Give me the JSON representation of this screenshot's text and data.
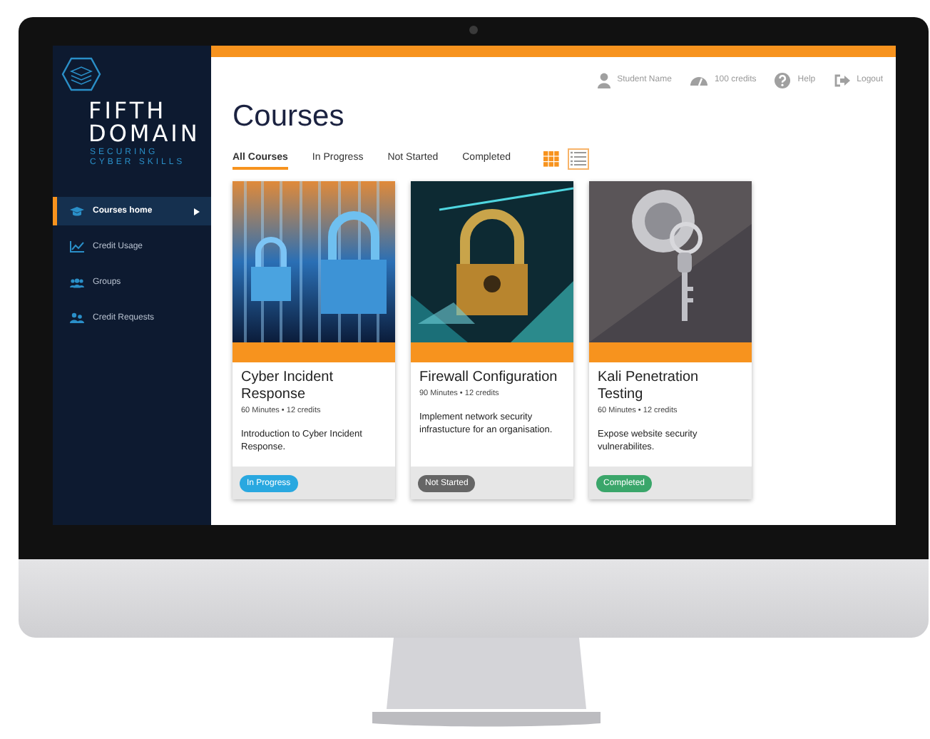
{
  "brand": {
    "name_line_1": "FIFTH",
    "name_line_2": "DOMAIN",
    "tagline_line_1": "SECURING",
    "tagline_line_2": "CYBER SKILLS"
  },
  "sidebar": {
    "items": [
      {
        "label": "Courses home",
        "kind": "courses",
        "selected": true
      },
      {
        "label": "Credit Usage",
        "kind": "chart",
        "selected": false
      },
      {
        "label": "Groups",
        "kind": "groups",
        "selected": false
      },
      {
        "label": "Credit Requests",
        "kind": "requests",
        "selected": false
      }
    ]
  },
  "header": {
    "links": [
      {
        "label": "Student Name",
        "kind": "user"
      },
      {
        "label": "100 credits",
        "kind": "credits"
      },
      {
        "label": "Help",
        "kind": "help"
      },
      {
        "label": "Logout",
        "kind": "logout"
      }
    ]
  },
  "page_title": "Courses",
  "tabs": [
    {
      "label": "All Courses",
      "selected": true
    },
    {
      "label": "In Progress",
      "selected": false
    },
    {
      "label": "Not Started",
      "selected": false
    },
    {
      "label": "Completed",
      "selected": false
    }
  ],
  "view_toggle": [
    {
      "kind": "grid",
      "selected": false
    },
    {
      "kind": "list",
      "selected": true
    }
  ],
  "courses": [
    {
      "title": "Cyber Incident Response",
      "meta": "60 Minutes • 12 credits",
      "description": "Introduction to Cyber Incident Response.",
      "status": {
        "label": "In Progress",
        "color": "#29a8e0"
      }
    },
    {
      "title": "Firewall Configuration",
      "meta": "90 Minutes • 12 credits",
      "description": "Implement network security infrastucture for an organisation.",
      "status": {
        "label": "Not Started",
        "color": "#666666"
      }
    },
    {
      "title": "Kali Penetration Testing",
      "meta": "60 Minutes • 12 credits",
      "description": "Expose website security vulnerabilites.",
      "status": {
        "label": "Completed",
        "color": "#3aa66a"
      }
    }
  ]
}
